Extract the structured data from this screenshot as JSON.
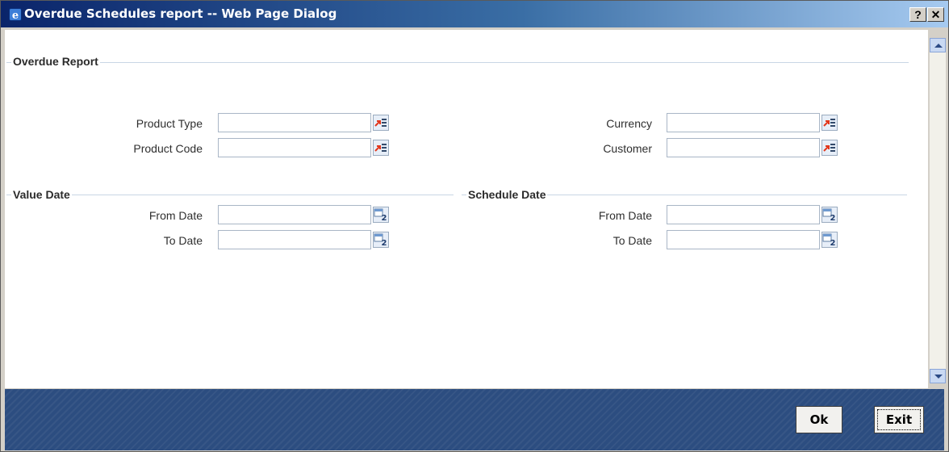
{
  "window": {
    "title": "Overdue Schedules report -- Web Page Dialog",
    "help_label": "?",
    "close_label": "✕"
  },
  "overdue_report": {
    "label": "Overdue Report",
    "product_type": {
      "label": "Product Type",
      "value": ""
    },
    "product_code": {
      "label": "Product Code",
      "value": ""
    },
    "currency": {
      "label": "Currency",
      "value": ""
    },
    "customer": {
      "label": "Customer",
      "value": ""
    }
  },
  "value_date": {
    "label": "Value Date",
    "from_date": {
      "label": "From Date",
      "value": ""
    },
    "to_date": {
      "label": "To Date",
      "value": ""
    }
  },
  "schedule_date": {
    "label": "Schedule Date",
    "from_date": {
      "label": "From Date",
      "value": ""
    },
    "to_date": {
      "label": "To Date",
      "value": ""
    }
  },
  "footer": {
    "ok_label": "Ok",
    "exit_label": "Exit"
  },
  "icons": {
    "lov": "list-of-values-icon",
    "calendar": "calendar-icon",
    "app": "ie-dialog-icon"
  }
}
